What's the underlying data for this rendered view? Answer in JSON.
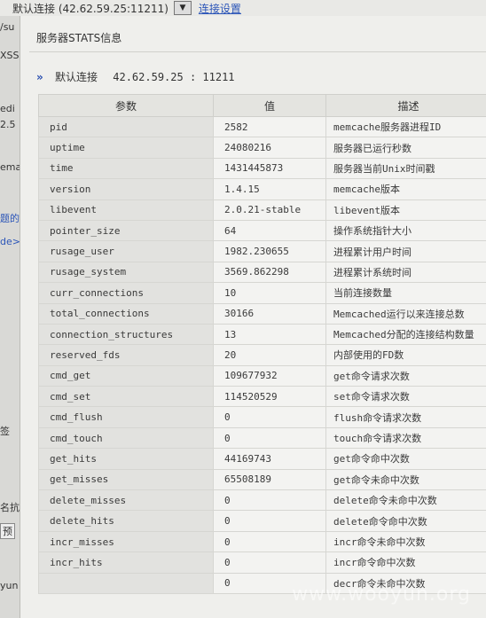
{
  "background": {
    "connection_text": "默认连接 (42.62.59.25:11211)",
    "dropdown_glyph": "▼",
    "settings_link": "连接设置",
    "left_fragments": [
      "/su",
      "XSS",
      "edi",
      "2.5",
      "ema",
      "题的",
      "de>",
      "签",
      "名抗",
      "预",
      "yun"
    ]
  },
  "panel": {
    "title": "服务器STATS信息",
    "subhead_arrow": "»",
    "subhead_label": "默认连接",
    "subhead_addr": "42.62.59.25 : 11211"
  },
  "table": {
    "headers": [
      "参数",
      "值",
      "描述"
    ],
    "rows": [
      {
        "param": "pid",
        "value": "2582",
        "desc": "memcache服务器进程ID"
      },
      {
        "param": "uptime",
        "value": "24080216",
        "desc": "服务器已运行秒数"
      },
      {
        "param": "time",
        "value": "1431445873",
        "desc": "服务器当前Unix时间戳"
      },
      {
        "param": "version",
        "value": "1.4.15",
        "desc": "memcache版本"
      },
      {
        "param": "libevent",
        "value": "2.0.21-stable",
        "desc": "libevent版本"
      },
      {
        "param": "pointer_size",
        "value": "64",
        "desc": "操作系统指针大小"
      },
      {
        "param": "rusage_user",
        "value": "1982.230655",
        "desc": "进程累计用户时间"
      },
      {
        "param": "rusage_system",
        "value": "3569.862298",
        "desc": "进程累计系统时间"
      },
      {
        "param": "curr_connections",
        "value": "10",
        "desc": "当前连接数量"
      },
      {
        "param": "total_connections",
        "value": "30166",
        "desc": "Memcached运行以来连接总数"
      },
      {
        "param": "connection_structures",
        "value": "13",
        "desc": "Memcached分配的连接结构数量"
      },
      {
        "param": "reserved_fds",
        "value": "20",
        "desc": "内部使用的FD数"
      },
      {
        "param": "cmd_get",
        "value": "109677932",
        "desc": "get命令请求次数"
      },
      {
        "param": "cmd_set",
        "value": "114520529",
        "desc": "set命令请求次数"
      },
      {
        "param": "cmd_flush",
        "value": "0",
        "desc": "flush命令请求次数"
      },
      {
        "param": "cmd_touch",
        "value": "0",
        "desc": "touch命令请求次数"
      },
      {
        "param": "get_hits",
        "value": "44169743",
        "desc": "get命令命中次数"
      },
      {
        "param": "get_misses",
        "value": "65508189",
        "desc": "get命令未命中次数"
      },
      {
        "param": "delete_misses",
        "value": "0",
        "desc": "delete命令未命中次数"
      },
      {
        "param": "delete_hits",
        "value": "0",
        "desc": "delete命令命中次数"
      },
      {
        "param": "incr_misses",
        "value": "0",
        "desc": "incr命令未命中次数"
      },
      {
        "param": "incr_hits",
        "value": "0",
        "desc": "incr命令命中次数"
      },
      {
        "param": "",
        "value": "0",
        "desc": "decr命令未命中次数"
      }
    ]
  },
  "watermark": "www.wooyun.org"
}
